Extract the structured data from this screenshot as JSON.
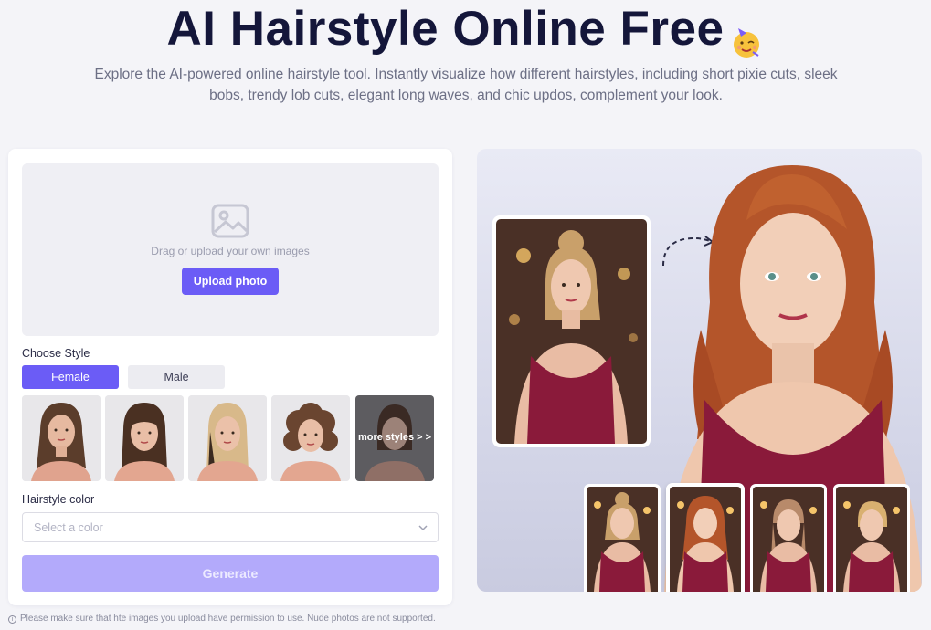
{
  "hero": {
    "title": "AI Hairstyle Online Free",
    "subtitle": "Explore the AI-powered online hairstyle tool. Instantly visualize how different hairstyles, including short pixie cuts, sleek bobs, trendy lob cuts, elegant long waves, and chic updos, complement your look."
  },
  "upload": {
    "drop_text": "Drag or upload your own images",
    "button_label": "Upload photo"
  },
  "style": {
    "label": "Choose Style",
    "genders": [
      {
        "label": "Female",
        "selected": true
      },
      {
        "label": "Male",
        "selected": false
      }
    ],
    "thumbnails": [
      {
        "icon": "long-waves-thumbnail"
      },
      {
        "icon": "bangs-straight-thumbnail"
      },
      {
        "icon": "long-blonde-thumbnail"
      },
      {
        "icon": "curly-bob-thumbnail"
      }
    ],
    "more_label": "more styles > >"
  },
  "color": {
    "label": "Hairstyle color",
    "placeholder": "Select a color"
  },
  "generate_label": "Generate",
  "disclaimer": "Please make sure that hte images you upload have permission to use. Nude photos are not supported.",
  "colors": {
    "accent": "#6b5cf6",
    "accent_disabled": "#b3aafb",
    "title": "#14163a",
    "dress": "#8a1a3a",
    "hair_auburn": "#b4552a",
    "hair_blonde": "#d9b070"
  }
}
